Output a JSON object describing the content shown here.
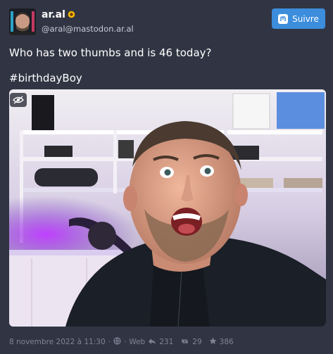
{
  "status": {
    "display_name": "ar.al",
    "emoji": "sunflower-icon",
    "handle": "@aral@mastodon.ar.al",
    "follow_label": "Suivre",
    "text": "Who has two thumbs and is 46 today?",
    "hashtag": "#birthdayBoy",
    "timestamp": "8 novembre 2022 à 11:30",
    "separator": "·",
    "app": "Web",
    "replies": "231",
    "boosts": "29",
    "favourites": "386"
  },
  "colors": {
    "background": "#313543",
    "follow_button": "#3c8ddc",
    "muted_text": "#7f8495"
  }
}
